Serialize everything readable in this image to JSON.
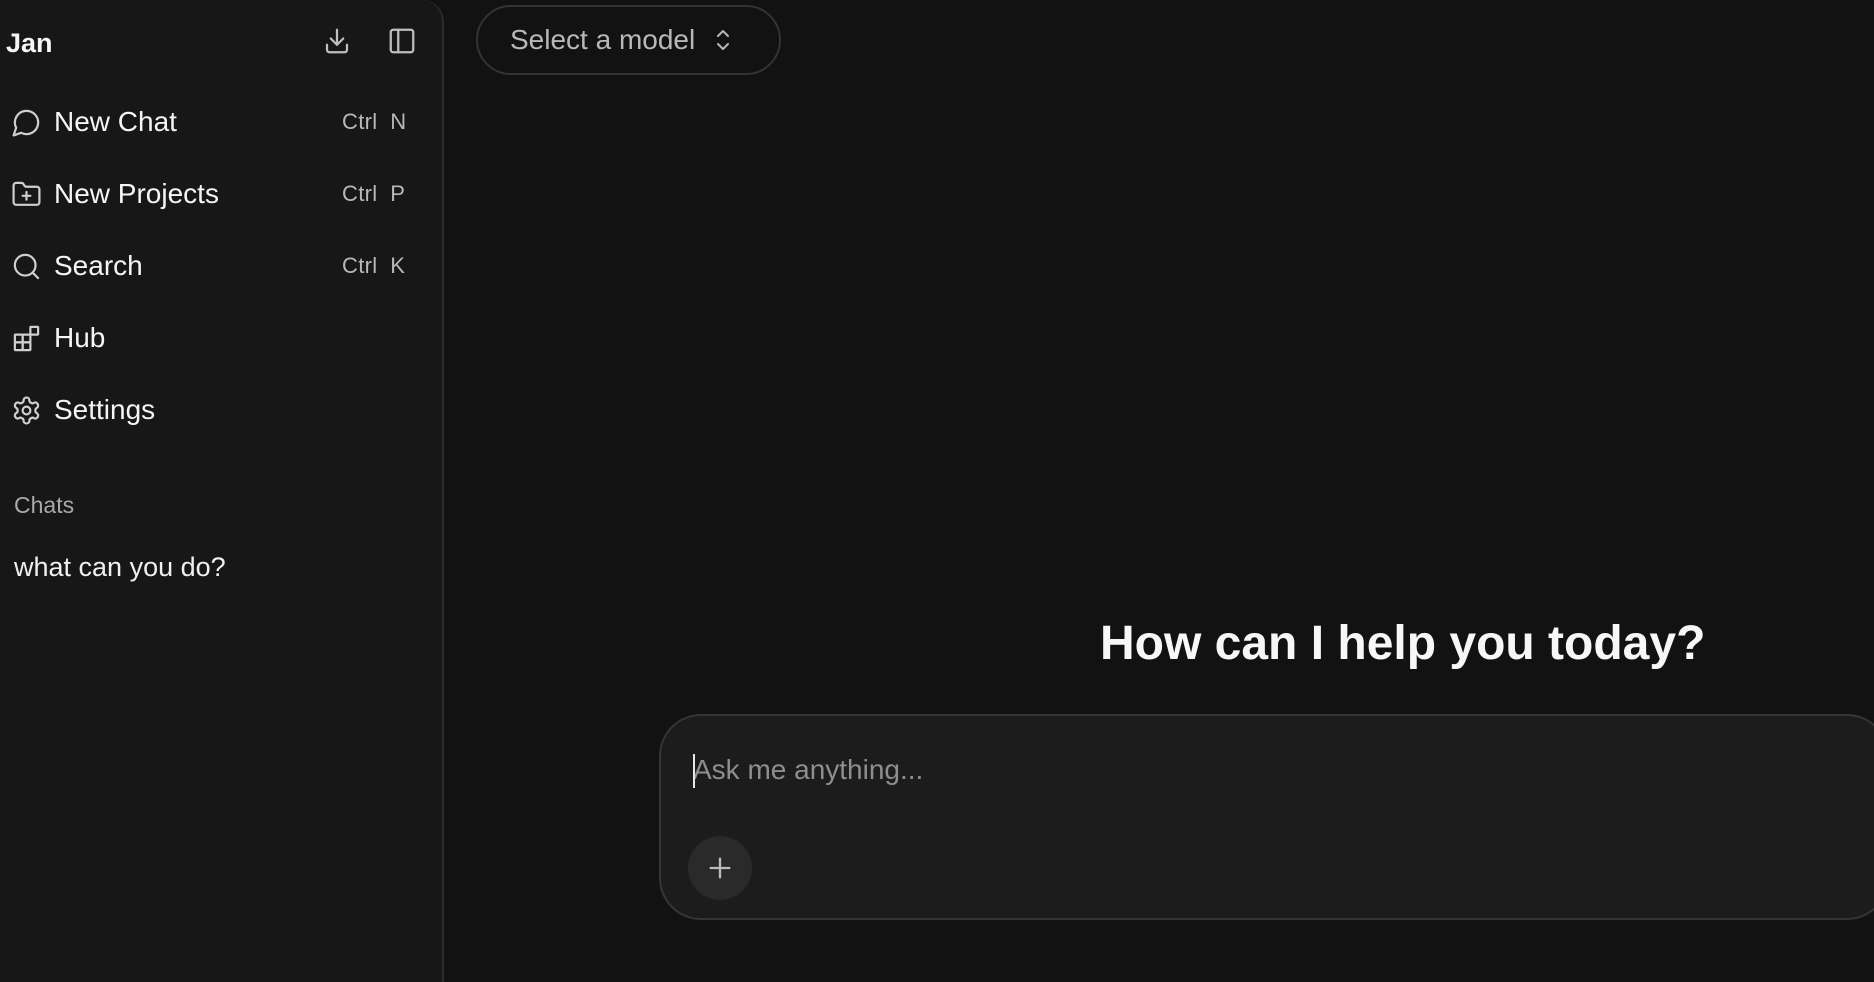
{
  "sidebar": {
    "brand": "Jan",
    "top_icons": [
      {
        "name": "download-icon"
      },
      {
        "name": "sidebar-toggle-icon"
      }
    ],
    "nav": [
      {
        "label": "New Chat",
        "shortcut": "Ctrl  N",
        "icon": "chat-bubble-icon"
      },
      {
        "label": "New Projects",
        "shortcut": "Ctrl  P",
        "icon": "folder-plus-icon"
      },
      {
        "label": "Search",
        "shortcut": "Ctrl  K",
        "icon": "search-icon"
      },
      {
        "label": "Hub",
        "shortcut": "",
        "icon": "apps-grid-icon"
      },
      {
        "label": "Settings",
        "shortcut": "",
        "icon": "gear-icon"
      }
    ],
    "section_label": "Chats",
    "chats": [
      {
        "title": "what can you do?"
      }
    ]
  },
  "header": {
    "model_select_label": "Select a model"
  },
  "main": {
    "greeting": "How can I help you today?",
    "composer": {
      "placeholder": "Ask me anything...",
      "value": ""
    }
  }
}
